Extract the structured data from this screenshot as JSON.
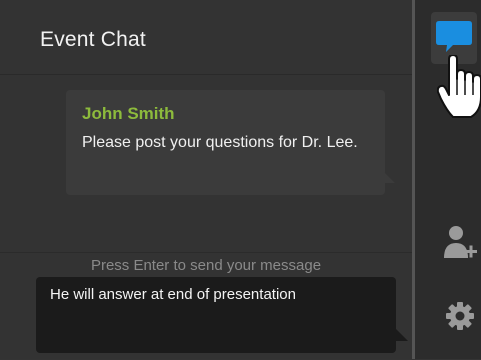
{
  "chat": {
    "title": "Event Chat",
    "messages": [
      {
        "sender": "John Smith",
        "text": "Please post your questions for Dr. Lee."
      }
    ]
  },
  "composer": {
    "hint": "Press Enter to send your message",
    "value": "He will answer at end of presentation"
  },
  "toolbar": {
    "items": [
      {
        "icon": "chat-bubble-icon",
        "active": true
      },
      {
        "icon": "add-user-icon",
        "active": false
      },
      {
        "icon": "gear-icon",
        "active": false
      }
    ]
  },
  "colors": {
    "accent": "#1a8ee0",
    "sender": "#8dbb3c"
  }
}
